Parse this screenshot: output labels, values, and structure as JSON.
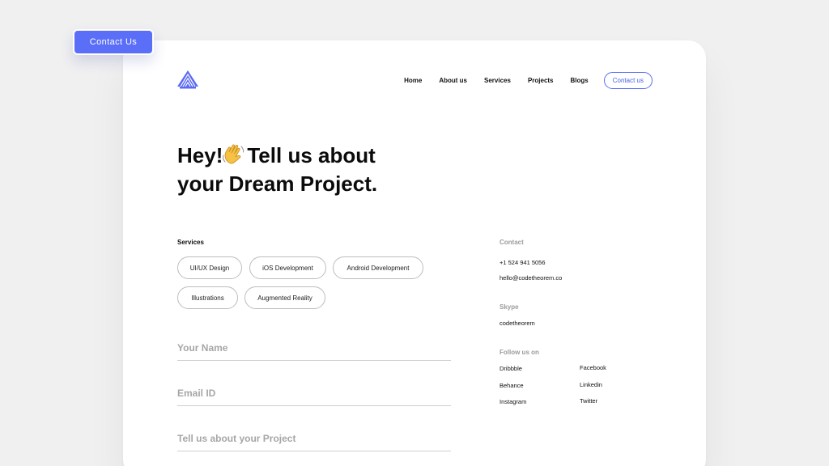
{
  "floating_button": {
    "label": "Contact Us"
  },
  "colors": {
    "accent": "#5a6ef8",
    "logo": "#5b6af5",
    "page_bg": "#f0f0f1"
  },
  "logo": {
    "icon": "triangle-logo-icon"
  },
  "nav": {
    "items": [
      "Home",
      "About us",
      "Services",
      "Projects",
      "Blogs"
    ],
    "cta": "Contact us"
  },
  "hero": {
    "line1_before": "Hey!",
    "emoji": "waving-hand-icon",
    "line1_after": "Tell us about",
    "line2": "your Dream Project."
  },
  "services": {
    "label": "Services",
    "chips": [
      "UI/UX Design",
      "iOS Development",
      "Android Development",
      "Illustrations",
      "Augmented Reality"
    ]
  },
  "form": {
    "name_placeholder": "Your Name",
    "email_placeholder": "Email ID",
    "project_placeholder": "Tell us about your Project"
  },
  "contact": {
    "heading": "Contact",
    "phone": "+1 524 941 5056",
    "email": "hello@codetheorem.co"
  },
  "skype": {
    "heading": "Skype",
    "handle": "codetheorem"
  },
  "social": {
    "heading": "Follow us on",
    "links": [
      "Dribbble",
      "Facebook",
      "Behance",
      "Linkedin",
      "Instagram",
      "Twitter"
    ]
  }
}
